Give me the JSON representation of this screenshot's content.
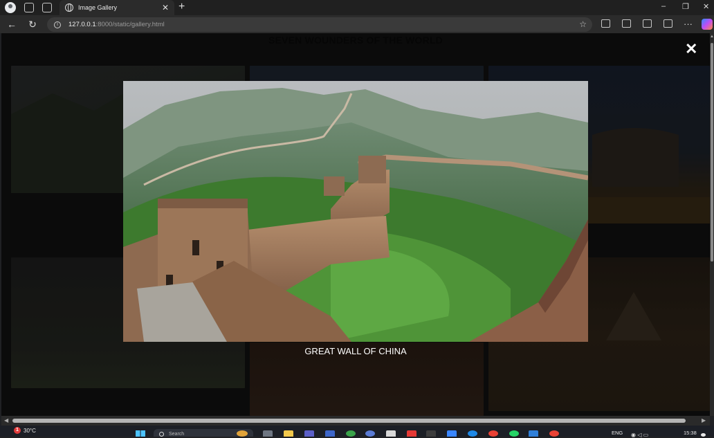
{
  "browser": {
    "tab_title": "Image Gallery",
    "tab_close": "✕",
    "new_tab": "+",
    "url_host": "127.0.0.1",
    "url_rest": ":8000/static/gallery.html",
    "minimize": "–",
    "restore": "❐",
    "close": "✕"
  },
  "page": {
    "title": "SEVEN WOUNDERS OF THE WORLD"
  },
  "modal": {
    "close_label": "✕",
    "caption": "GREAT WALL OF CHINA"
  },
  "taskbar": {
    "weather_alert": "1",
    "temperature": "30°C",
    "search_placeholder": "Search",
    "language": "ENG",
    "time": "15:38"
  },
  "colors": {
    "modal_backdrop": "#121212",
    "title_text": "#0a0a0a",
    "caption_text": "#ffffff"
  }
}
